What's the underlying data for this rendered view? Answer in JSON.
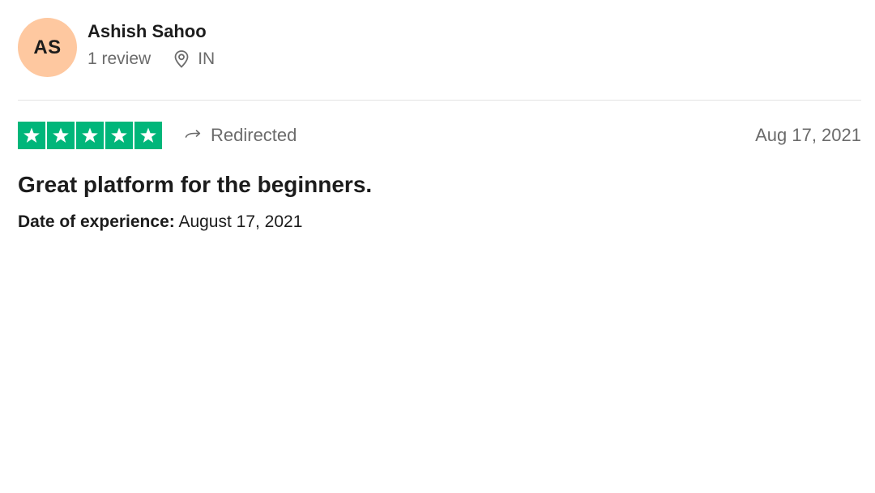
{
  "reviewer": {
    "initials": "AS",
    "name": "Ashish Sahoo",
    "review_count": "1 review",
    "country": "IN",
    "avatar_color": "#fec8a0"
  },
  "review": {
    "rating": 5,
    "rating_max": 5,
    "star_color": "#00b67a",
    "source_label": "Redirected",
    "date": "Aug 17, 2021",
    "title": "Great platform for the beginners.",
    "experience_label": "Date of experience:",
    "experience_date": "August 17, 2021"
  },
  "icons": {
    "location": "location-pin-icon",
    "redirect": "redirect-arrow-icon",
    "star": "star-icon"
  }
}
